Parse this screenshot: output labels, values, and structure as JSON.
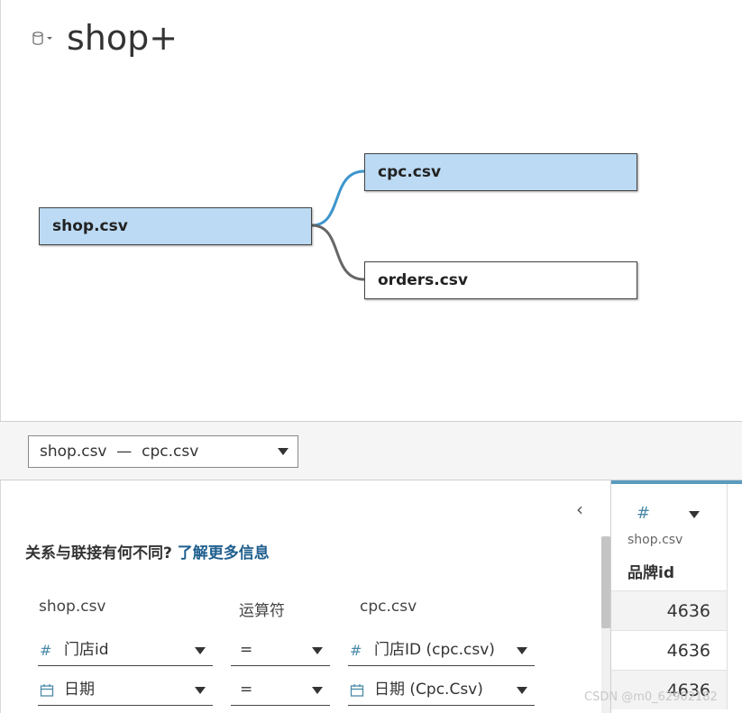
{
  "datasource": {
    "icon": "database-icon",
    "title": "shop+"
  },
  "canvas": {
    "tables": [
      {
        "name": "shop.csv",
        "selected": true
      },
      {
        "name": "cpc.csv",
        "selected": true
      },
      {
        "name": "orders.csv",
        "selected": false
      }
    ],
    "link_colors": {
      "selected": "#3d95cc",
      "normal": "#666666"
    }
  },
  "relationship": {
    "selected_label": "shop.csv  —  cpc.csv"
  },
  "panel": {
    "collapse_icon": "chevron-left-icon",
    "info_text": "关系与联接有何不同?",
    "info_link": "了解更多信息",
    "headers": {
      "left": "shop.csv",
      "operator": "运算符",
      "right": "cpc.csv"
    },
    "rows": [
      {
        "left_icon": "#",
        "left_field": "门店id",
        "operator": "=",
        "right_icon": "#",
        "right_field": "门店ID (cpc.csv)"
      },
      {
        "left_icon": "📅",
        "left_field": "日期",
        "operator": "=",
        "right_icon": "📅",
        "right_field": "日期 (Cpc.Csv)"
      }
    ]
  },
  "grid": {
    "type_icon": "#",
    "source": "shop.csv",
    "column": "品牌id",
    "values": [
      "4636",
      "4636",
      "4636"
    ]
  },
  "watermark": "CSDN @m0_62902182"
}
